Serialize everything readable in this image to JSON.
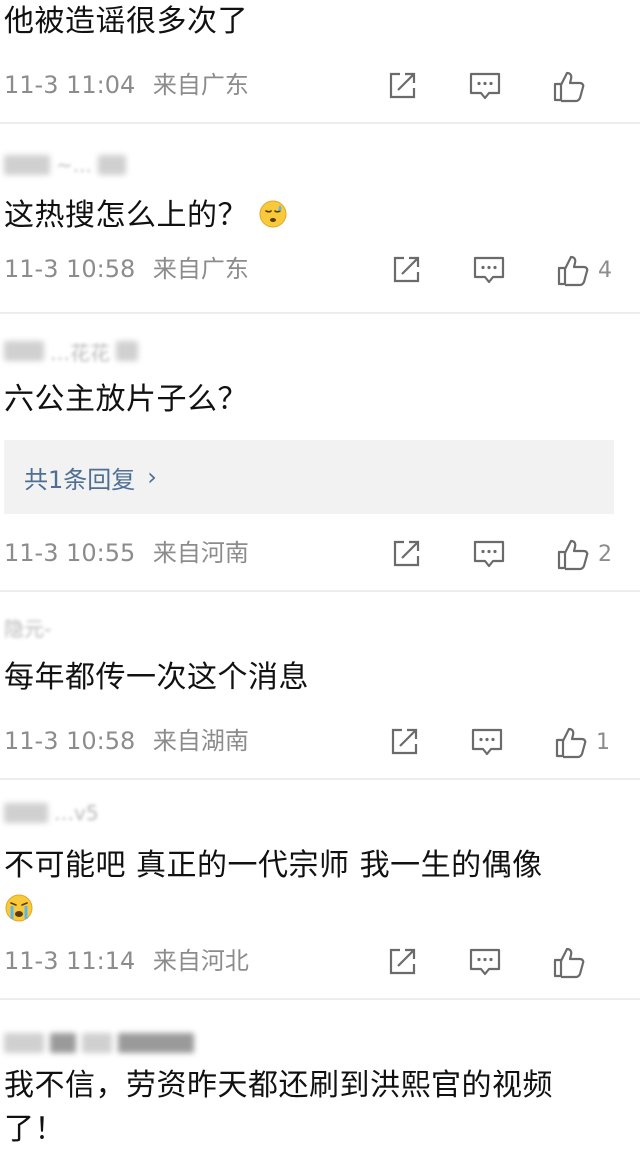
{
  "comments": [
    {
      "text": "他被造谣很多次了",
      "time": "11-3 11:04",
      "location": "来自广东",
      "likes": ""
    },
    {
      "username_fragment": "~...",
      "text": "这热搜怎么上的？",
      "emoji": "sweat-face-emoji",
      "time": "11-3 10:58",
      "location": "来自广东",
      "likes": "4"
    },
    {
      "username_fragment": "…花花",
      "text": "六公主放片子么？",
      "reply_summary": "共1条回复",
      "reply_chevron": "›",
      "time": "11-3 10:55",
      "location": "来自河南",
      "likes": "2"
    },
    {
      "username_fragment": "隐元-",
      "text": "每年都传一次这个消息",
      "time": "11-3 10:58",
      "location": "来自湖南",
      "likes": "1"
    },
    {
      "username_fragment": "…v5",
      "text": "不可能吧  真正的一代宗师  我一生的偶像",
      "emoji": "crying-face-emoji",
      "time": "11-3 11:14",
      "location": "来自河北",
      "likes": ""
    },
    {
      "text_line1": "我不信，劳资昨天都还刷到洪熙官的视频",
      "text_line2": "了！"
    }
  ],
  "icons": {
    "share": "share-icon",
    "comment": "comment-icon",
    "like": "like-icon",
    "icon_color": "#6b6b6b",
    "reply_link_color": "#4e6e94"
  }
}
